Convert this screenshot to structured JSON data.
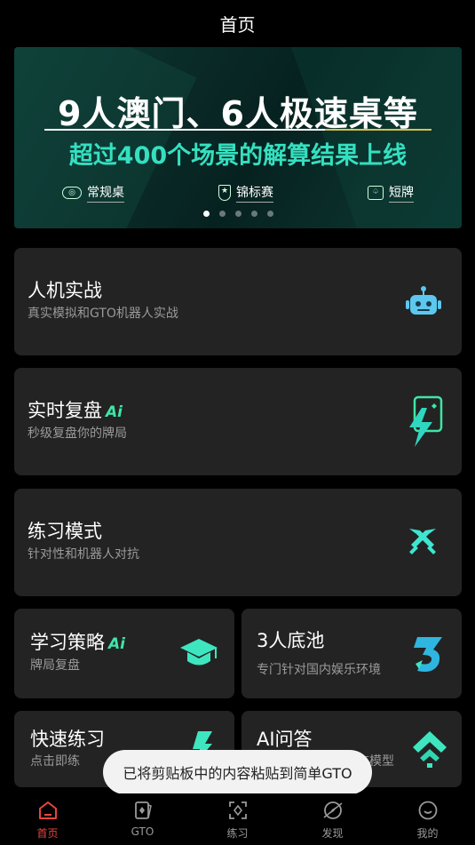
{
  "header": {
    "title": "首页"
  },
  "banner": {
    "headline": "9人澳门、6人极速桌等",
    "subline": "超过400个场景的解算结果上线",
    "tags": [
      {
        "label": "常规桌",
        "icon": "table-icon"
      },
      {
        "label": "锦标赛",
        "icon": "medal-icon"
      },
      {
        "label": "短牌",
        "icon": "cards-icon"
      }
    ],
    "dots": 5,
    "active_dot": 0,
    "accent_color": "#34e0c0"
  },
  "cards": {
    "ai_battle": {
      "title": "人机实战",
      "subtitle": "真实模拟和GTO机器人实战",
      "icon": "robot-icon"
    },
    "live_review": {
      "title": "实时复盘",
      "badge": "Ai",
      "subtitle": "秒级复盘你的牌局",
      "icon": "lightning-card-icon"
    },
    "practice": {
      "title": "练习模式",
      "subtitle": "针对性和机器人对抗",
      "icon": "crossed-swords-icon"
    },
    "strategy": {
      "title": "学习策略",
      "badge": "Ai",
      "subtitle": "牌局复盘",
      "icon": "graduation-cap-icon"
    },
    "three_pot": {
      "title": "3人底池",
      "subtitle": "专门针对国内娱乐环境",
      "icon": "number-3-icon"
    },
    "quick_practice": {
      "title": "快速练习",
      "subtitle": "点击即练",
      "icon": "lightning-icon"
    },
    "ai_qa": {
      "title": "AI问答",
      "subtitle": "言模型",
      "icon": "chevron-up-icon"
    }
  },
  "toast": {
    "text": "已将剪贴板中的内容粘贴到简单GTO"
  },
  "tabbar": {
    "items": [
      {
        "label": "首页",
        "icon": "home-icon",
        "active": true
      },
      {
        "label": "GTO",
        "icon": "gto-cards-icon",
        "active": false
      },
      {
        "label": "练习",
        "icon": "practice-scan-icon",
        "active": false
      },
      {
        "label": "发现",
        "icon": "discover-compass-icon",
        "active": false
      },
      {
        "label": "我的",
        "icon": "profile-smile-icon",
        "active": false
      }
    ],
    "active_color": "#e8453c"
  }
}
